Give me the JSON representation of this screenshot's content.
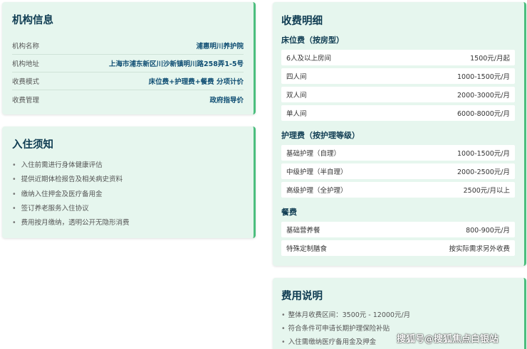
{
  "info": {
    "title": "机构信息",
    "rows": [
      {
        "label": "机构名称",
        "value": "浦惠明川养护院"
      },
      {
        "label": "机构地址",
        "value": "上海市浦东新区川沙新镇明川路258弄1-5号"
      },
      {
        "label": "收费模式",
        "value": "床位费+护理费+餐费 分项计价"
      },
      {
        "label": "收费管理",
        "value": "政府指导价"
      }
    ]
  },
  "notice": {
    "title": "入住须知",
    "items": [
      "入住前需进行身体健康评估",
      "提供近期体检报告及相关病史资料",
      "缴纳入住押金及医疗备用金",
      "签订养老服务入住协议",
      "费用按月缴纳，透明公开无隐形消费"
    ]
  },
  "fees": {
    "title": "收费明细",
    "groups": [
      {
        "title": "床位费（按房型）",
        "rows": [
          {
            "label": "6人及以上房间",
            "value": "1500元/月起"
          },
          {
            "label": "四人间",
            "value": "1000-1500元/月"
          },
          {
            "label": "双人间",
            "value": "2000-3000元/月"
          },
          {
            "label": "单人间",
            "value": "6000-8000元/月"
          }
        ]
      },
      {
        "title": "护理费（按护理等级）",
        "rows": [
          {
            "label": "基础护理（自理）",
            "value": "1000-1500元/月"
          },
          {
            "label": "中级护理（半自理）",
            "value": "2000-2500元/月"
          },
          {
            "label": "高级护理（全护理）",
            "value": "2500元/月以上"
          }
        ]
      },
      {
        "title": "餐费",
        "rows": [
          {
            "label": "基础营养餐",
            "value": "800-900元/月"
          },
          {
            "label": "特殊定制膳食",
            "value": "按实际需求另外收费"
          }
        ]
      }
    ]
  },
  "explain": {
    "title": "费用说明",
    "items": [
      "整体月收费区间：3500元 - 12000元/月",
      "符合条件可申请长期护理保险补贴",
      "入住需缴纳医疗备用金及押金"
    ]
  },
  "watermark": "搜狐号@搜狐焦点白银站",
  "colors": {
    "card_bg": "#e6f6ee",
    "accent": "#4cbe7e",
    "title": "#0f3c52",
    "value": "#0f4e73"
  }
}
